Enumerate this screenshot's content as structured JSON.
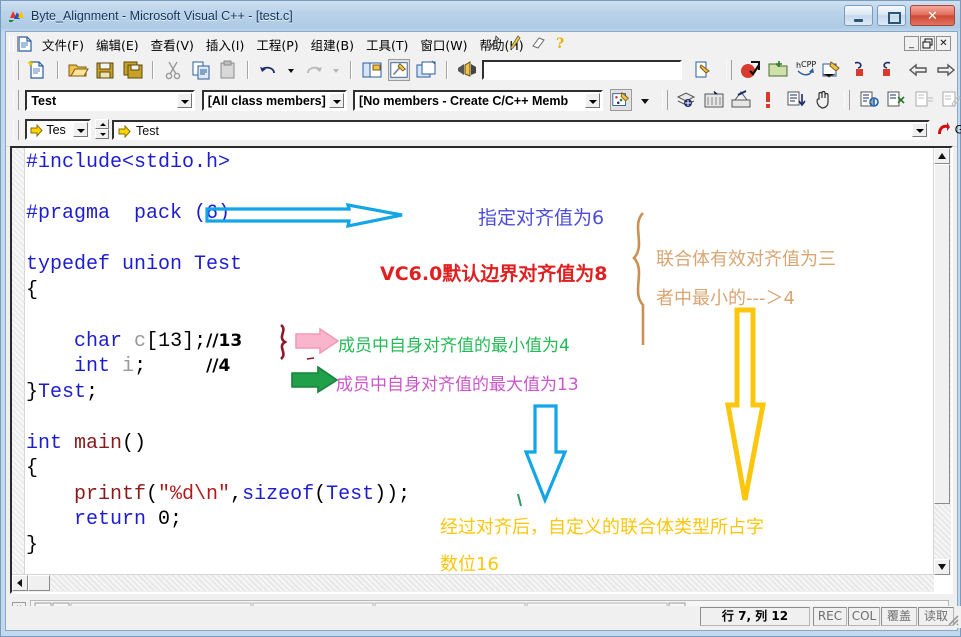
{
  "window": {
    "title": "Byte_Alignment - Microsoft Visual C++ - [test.c]",
    "icon": "vcpp-app-icon",
    "minimize_label": "–",
    "maximize_label": "□",
    "close_label": "✕"
  },
  "mdi": {
    "minimize": "_",
    "restore": "❐",
    "close": "✕"
  },
  "menu": {
    "doc_icon": "document-icon",
    "items": [
      {
        "label": "文件(F)",
        "key": "F"
      },
      {
        "label": "编辑(E)",
        "key": "E"
      },
      {
        "label": "查看(V)",
        "key": "V"
      },
      {
        "label": "插入(I)",
        "key": "I"
      },
      {
        "label": "工程(P)",
        "key": "P"
      },
      {
        "label": "组建(B)",
        "key": "B"
      },
      {
        "label": "工具(T)",
        "key": "T"
      },
      {
        "label": "窗口(W)",
        "key": "W"
      },
      {
        "label": "帮助(H)",
        "key": "H"
      }
    ],
    "trailing_icons": [
      "pin-icon",
      "pencil-icon",
      "eraser-icon",
      "help-question-icon"
    ]
  },
  "toolbar_standard": {
    "buttons": [
      "new-file-icon",
      "open-file-icon",
      "save-icon",
      "save-all-icon",
      "cut-icon",
      "copy-icon",
      "paste-icon",
      "undo-icon",
      "undo-dropdown-icon",
      "redo-icon",
      "redo-dropdown-icon",
      "workspace-icon",
      "output-window-icon",
      "window-list-icon",
      "find-in-files-icon"
    ],
    "search_value": "",
    "search_placeholder": "",
    "after_icons": [
      "compile-icon",
      "open-folder-icon",
      "cpp-icon",
      "find-icon",
      "bookmark-red-icon",
      "bookmark-red2-icon",
      "nav-back-icon",
      "nav-forward-icon",
      "clipboard-icon",
      "braces-icon",
      "comment-icon",
      "spellcheck-icon",
      "cplus-icon",
      "tomato-icon"
    ]
  },
  "toolbar_wizard": {
    "class_combo": "Test",
    "members_combo": "[All class members]",
    "create_combo": "[No members - Create C/C++ Memb",
    "wizard_icon": "classwizard-icon",
    "wizard_dropdown": "chevron-down-icon",
    "right_icons": [
      "compile-build-icon",
      "build-all-icon",
      "stop-build-icon",
      "exclaim-run-icon",
      "step-into-icon",
      "hand-icon",
      "insert-breakpoint-icon",
      "remove-breakpoint-icon",
      "disable-breakpoint-icon",
      "edit-breakpoint-icon",
      "run-arrow-icon",
      "step-over-icon",
      "step-out-icon",
      "step-return-icon"
    ]
  },
  "bookmark_bar": {
    "combo_value": "Tes",
    "label_icon": "yellow-arrow-icon",
    "label_value": "Test",
    "find_value": "",
    "go_label": "Go",
    "go_icon": "red-go-arrow-icon"
  },
  "editor": {
    "lines": [
      [
        {
          "t": "#include",
          "c": "pp"
        },
        {
          "t": "<stdio.h>",
          "c": "pp"
        }
      ],
      [],
      [
        {
          "t": "#pragma  pack (6)",
          "c": "pp"
        }
      ],
      [],
      [
        {
          "t": "typedef union Test",
          "c": "kw"
        }
      ],
      [
        {
          "t": "{",
          "c": "id"
        }
      ],
      [],
      [
        {
          "t": "    ",
          "c": "id"
        },
        {
          "t": "char",
          "c": "kw"
        },
        {
          "t": " ",
          "c": "id"
        },
        {
          "t": "c",
          "c": "gray"
        },
        {
          "t": "[13];",
          "c": "id"
        },
        {
          "t": "//13",
          "c": "cm"
        }
      ],
      [
        {
          "t": "    ",
          "c": "id"
        },
        {
          "t": "int",
          "c": "kw"
        },
        {
          "t": " ",
          "c": "id"
        },
        {
          "t": "i",
          "c": "gray"
        },
        {
          "t": ";    ",
          "c": "id"
        },
        {
          "t": "//4",
          "c": "cm"
        }
      ],
      [
        {
          "t": "}",
          "c": "id"
        },
        {
          "t": "Test",
          "c": "kw"
        },
        {
          "t": ";",
          "c": "id"
        }
      ],
      [],
      [
        {
          "t": "int",
          "c": "kw"
        },
        {
          "t": " ",
          "c": "id"
        },
        {
          "t": "main",
          "c": "fn"
        },
        {
          "t": "()",
          "c": "id"
        }
      ],
      [
        {
          "t": "{",
          "c": "id"
        }
      ],
      [
        {
          "t": "    ",
          "c": "id"
        },
        {
          "t": "printf",
          "c": "fn"
        },
        {
          "t": "(",
          "c": "id"
        },
        {
          "t": "\"%d\\n\"",
          "c": "str"
        },
        {
          "t": ",",
          "c": "id"
        },
        {
          "t": "sizeof",
          "c": "kw"
        },
        {
          "t": "(",
          "c": "id"
        },
        {
          "t": "Test",
          "c": "kw"
        },
        {
          "t": "));",
          "c": "id"
        }
      ],
      [
        {
          "t": "    ",
          "c": "id"
        },
        {
          "t": "return",
          "c": "kw"
        },
        {
          "t": " 0;",
          "c": "id"
        }
      ],
      [
        {
          "t": "}",
          "c": "id"
        }
      ]
    ]
  },
  "annotations": {
    "pragma_note": "指定对齐值为6",
    "default_note": "VC6.0默认边界对齐值为8",
    "union_note_line1": "联合体有效对齐值为三",
    "union_note_line2": "者中最小的---＞4",
    "min_note": "成员中自身对齐值的最小值为4",
    "max_note": "成员中自身对齐值的最大值为13",
    "result_line1": "经过对齐后，自定义的联合体类型所占字",
    "result_line2": "数位16",
    "colors": {
      "blue_arrow": "#12a5e8",
      "blue_text": "#4d4ddd",
      "red_text": "#e02020",
      "tan_brace": "#c98f53",
      "tan_text": "#d8a573",
      "pink_arrow": "#f9b5cc",
      "green_text": "#22bb55",
      "green_arrow": "#21a04a",
      "purple_text": "#cc55cc",
      "dark_red_brace": "#8b1a2b",
      "cyan_arrow": "#12a5e8",
      "yellow_arrow": "#fcc60c",
      "yellow_text": "#fcc60c"
    }
  },
  "statusbar": {
    "position": "行 7, 列 12",
    "rec": "REC",
    "col": "COL",
    "ovr": "覆盖",
    "read": "读取"
  }
}
